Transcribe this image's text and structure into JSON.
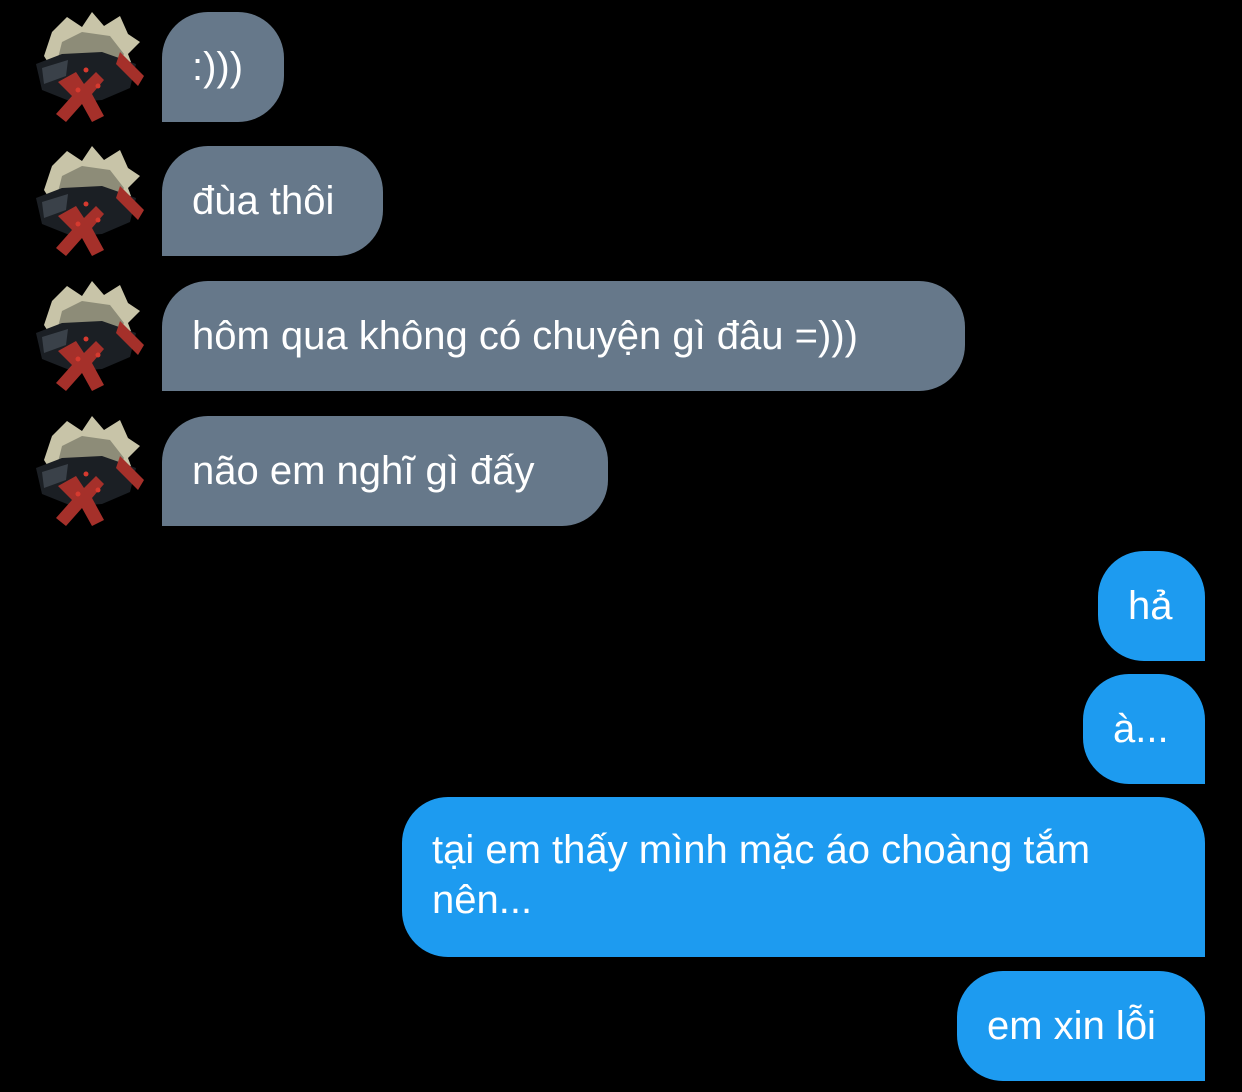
{
  "conversation": {
    "incoming": [
      {
        "text": ":)))"
      },
      {
        "text": "đùa thôi"
      },
      {
        "text": "hôm qua không có chuyện gì đâu =)))"
      },
      {
        "text": "não em nghĩ gì đấy"
      }
    ],
    "outgoing": [
      {
        "text": "hả"
      },
      {
        "text": "à..."
      },
      {
        "text": "tại em thấy mình mặc áo choàng tắm nên..."
      },
      {
        "text": "em xin lỗi"
      }
    ]
  },
  "colors": {
    "background": "#000000",
    "incoming_bubble": "#66788a",
    "outgoing_bubble": "#1d9bf0",
    "text": "#ffffff"
  },
  "icons": {
    "avatar": "avatar-icon"
  }
}
